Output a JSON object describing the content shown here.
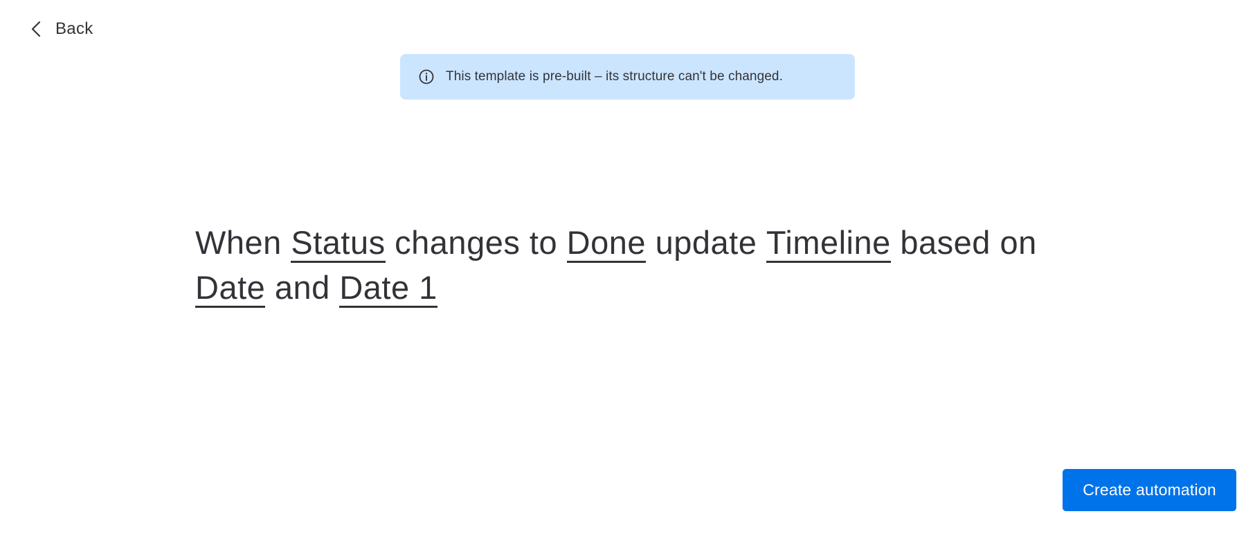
{
  "header": {
    "back_label": "Back"
  },
  "notice": {
    "icon": "info-icon",
    "text": "This template is pre-built – its structure can't be changed."
  },
  "recipe": {
    "part1": "When ",
    "token_status": "Status",
    "part2": " changes to ",
    "token_done": "Done",
    "part3": " update ",
    "token_timeline": "Timeline",
    "part4": " based on ",
    "token_date": "Date",
    "part5": " and ",
    "token_date1": "Date 1"
  },
  "footer": {
    "create_label": "Create automation"
  },
  "colors": {
    "accent": "#0073ea",
    "notice_bg": "#cce5ff",
    "text": "#323338"
  }
}
